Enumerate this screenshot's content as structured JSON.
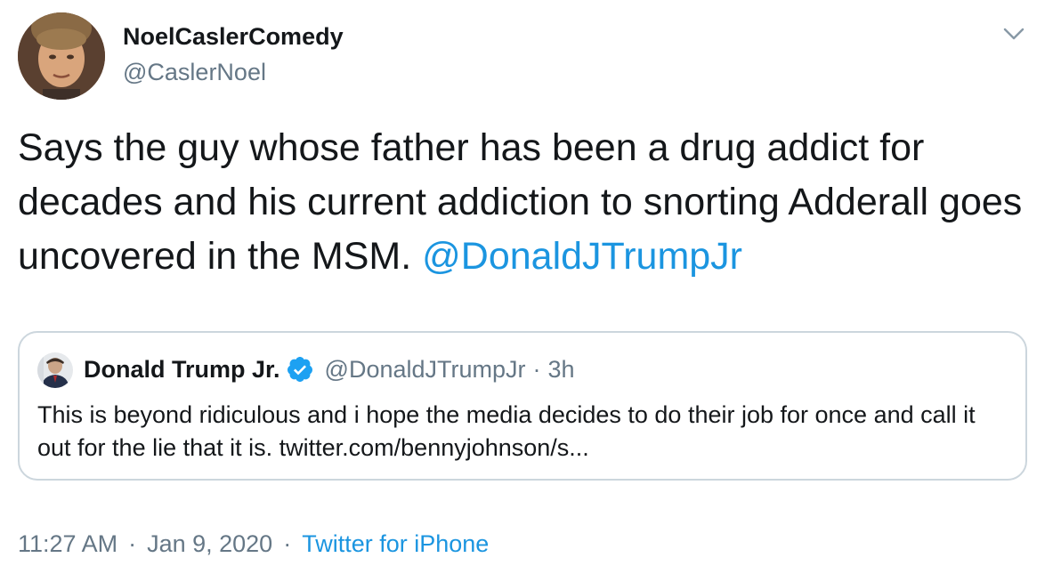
{
  "author": {
    "display_name": "NoelCaslerComedy",
    "handle": "@CaslerNoel",
    "avatar_icon": "profile-photo"
  },
  "tweet": {
    "text": "Says the guy whose father has been a drug addict for decades and his current addiction to snorting Adderall goes uncovered in the MSM.",
    "mention": "@DonaldJTrumpJr"
  },
  "quoted_tweet": {
    "display_name": "Donald Trump Jr.",
    "verified_icon": "verified-badge-icon",
    "handle": "@DonaldJTrumpJr",
    "separator": "·",
    "time": "3h",
    "text": "This is beyond ridiculous and i hope the media decides to do their job for once and call it out for the lie that it is. twitter.com/bennyjohnson/s..."
  },
  "meta": {
    "time": "11:27 AM",
    "separator": "·",
    "date": "Jan 9, 2020",
    "source": "Twitter for iPhone"
  },
  "colors": {
    "link": "#1b95e0",
    "secondary_text": "#657786",
    "border": "#ccd6dd",
    "primary_text": "#14171a"
  }
}
